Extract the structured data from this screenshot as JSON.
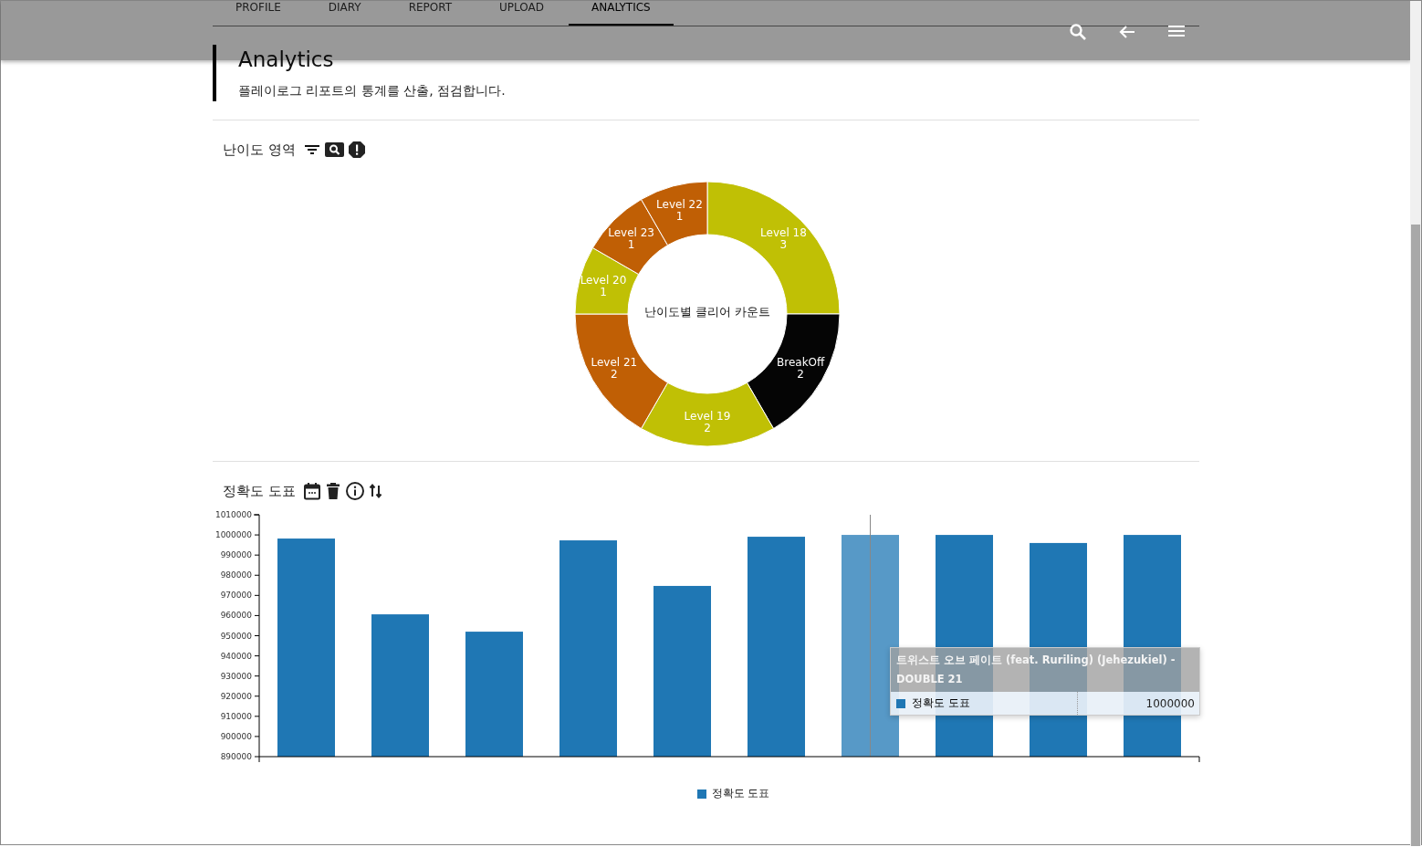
{
  "tabs": [
    {
      "label": "PROFILE",
      "selected": false
    },
    {
      "label": "DIARY",
      "selected": false
    },
    {
      "label": "REPORT",
      "selected": false
    },
    {
      "label": "UPLOAD",
      "selected": false
    },
    {
      "label": "ANALYTICS",
      "selected": true
    }
  ],
  "page_header": {
    "title": "Analytics",
    "subtitle": "플레이로그 리포트의 통계를 산출, 점검합니다."
  },
  "difficulty_section": {
    "title": "난이도 영역",
    "chart_data": {
      "type": "donut",
      "title": "난이도별 클리어 카운트",
      "categories": [
        "Level 18",
        "BreakOff",
        "Level 19",
        "Level 21",
        "Level 20",
        "Level 23",
        "Level 22"
      ],
      "series": [
        {
          "values": [
            3,
            2,
            2,
            2,
            1,
            1,
            1
          ]
        }
      ],
      "colors": [
        "#c0c005",
        "#050505",
        "#c0c005",
        "#c05f05",
        "#c0c005",
        "#c05f05",
        "#c05f05"
      ],
      "data_labels": true
    }
  },
  "accuracy_section": {
    "title": "정확도 도표",
    "chart_data": {
      "type": "bar",
      "ylim": [
        890000,
        1010000
      ],
      "yticks": [
        {
          "value": 890000,
          "label": "890000"
        },
        {
          "value": 900000,
          "label": "900000"
        },
        {
          "value": 910000,
          "label": "910000"
        },
        {
          "value": 920000,
          "label": "920000"
        },
        {
          "value": 930000,
          "label": "930000"
        },
        {
          "value": 940000,
          "label": "940000"
        },
        {
          "value": 950000,
          "label": "950000"
        },
        {
          "value": 960000,
          "label": "960000"
        },
        {
          "value": 970000,
          "label": "970000"
        },
        {
          "value": 980000,
          "label": "980000"
        },
        {
          "value": 990000,
          "label": "990000"
        },
        {
          "value": 1000000,
          "label": "1000000"
        },
        {
          "value": 1010000,
          "label": "1010000"
        }
      ],
      "series": [
        {
          "name": "정확도 도표",
          "color": "#1f77b4",
          "values": [
            998200,
            960600,
            952000,
            997300,
            974700,
            999100,
            1000000,
            1000000,
            996000,
            1000000
          ]
        }
      ]
    },
    "bars": [
      {
        "selected": false
      },
      {
        "selected": false
      },
      {
        "selected": false
      },
      {
        "selected": false
      },
      {
        "selected": false
      },
      {
        "selected": false
      },
      {
        "selected": true
      },
      {
        "selected": false
      },
      {
        "selected": false
      },
      {
        "selected": false
      }
    ],
    "tooltip": {
      "title": "트위스트 오브 페이트 (feat. Ruriling) (Jehezukiel) - DOUBLE 21",
      "series_name": "정확도 도표",
      "value": "1000000"
    }
  }
}
